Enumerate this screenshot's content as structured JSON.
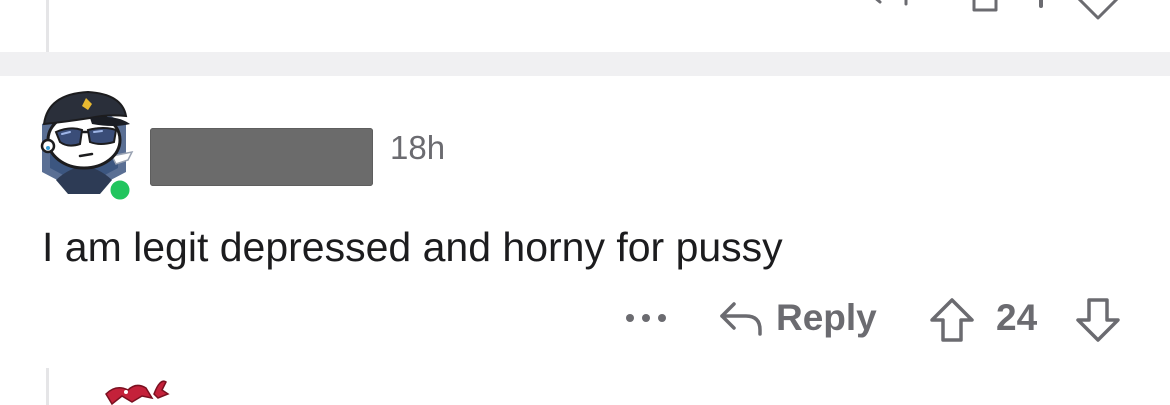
{
  "previous_comment": {
    "icons": [
      "more-icon",
      "reply-icon",
      "upvote-icon",
      "downvote-icon"
    ]
  },
  "comment": {
    "avatar": "snoo-avatar-police-cap-sunglasses",
    "online_indicator_color": "#22c55e",
    "username": "",
    "timestamp": "18h",
    "body": "I am legit depressed and horny for pussy",
    "actions": {
      "more_icon": "more-icon",
      "reply_label": "Reply",
      "reply_icon": "reply-icon",
      "upvote_icon": "upvote-icon",
      "vote_count": "24",
      "downvote_icon": "downvote-icon"
    }
  },
  "next_comment": {
    "avatar": "snoo-avatar-red"
  },
  "colors": {
    "text_primary": "#1c1c1e",
    "text_secondary": "#6b6b70",
    "separator": "#f0f0f2",
    "thread_line": "#e5e5e7",
    "redaction": "#6b6b6b"
  }
}
